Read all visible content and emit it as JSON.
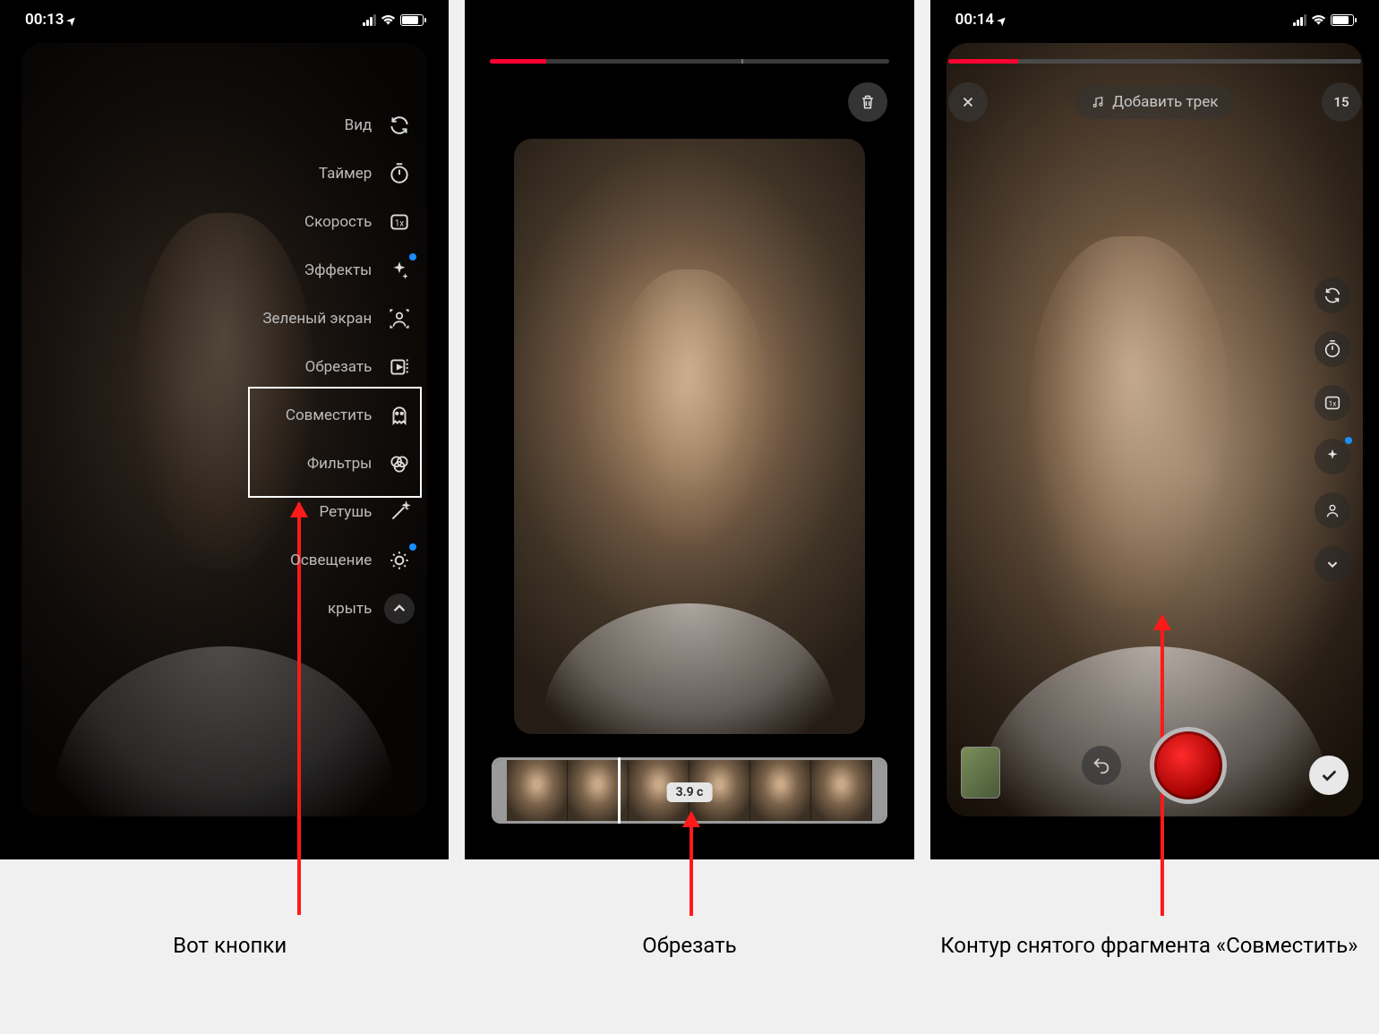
{
  "status": {
    "time1": "00:13",
    "time3": "00:14"
  },
  "screen1": {
    "tools": [
      {
        "label": "Вид",
        "icon": "refresh"
      },
      {
        "label": "Таймер",
        "icon": "timer"
      },
      {
        "label": "Скорость",
        "icon": "speed"
      },
      {
        "label": "Эффекты",
        "icon": "effects"
      },
      {
        "label": "Зеленый экран",
        "icon": "greenscreen"
      },
      {
        "label": "Обрезать",
        "icon": "crop"
      },
      {
        "label": "Совместить",
        "icon": "align"
      },
      {
        "label": "Фильтры",
        "icon": "filters"
      },
      {
        "label": "Ретушь",
        "icon": "retouch"
      },
      {
        "label": "Освещение",
        "icon": "lighting"
      },
      {
        "label": "крыть",
        "icon": "collapse"
      }
    ]
  },
  "screen2": {
    "trim_duration": "3.9 с"
  },
  "screen3": {
    "add_track": "Добавить трек",
    "timer_badge": "15"
  },
  "annotations": {
    "cap1": "Вот кнопки",
    "cap2": "Обрезать",
    "cap3": "Контур снятого фрагмента «Совместить»"
  }
}
